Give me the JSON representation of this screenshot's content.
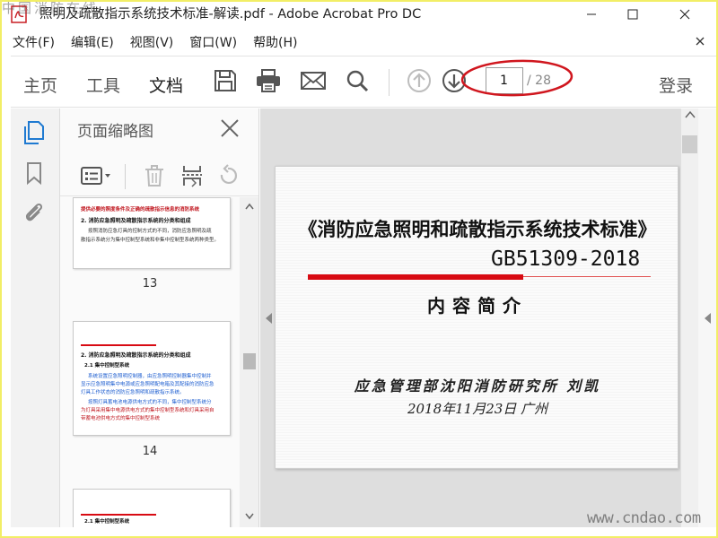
{
  "window": {
    "title": "照明及疏散指示系统技术标准-解读.pdf - Adobe Acrobat Pro DC"
  },
  "watermark": {
    "top": "中国消防在线",
    "bottom": "www.cndao.com"
  },
  "menu": {
    "items": [
      "文件(F)",
      "编辑(E)",
      "视图(V)",
      "窗口(W)",
      "帮助(H)"
    ]
  },
  "toolbar": {
    "tabs": [
      "主页",
      "工具",
      "文档"
    ],
    "active_tab": "文档",
    "icons": [
      "save-icon",
      "print-icon",
      "email-icon",
      "search-icon",
      "prev-page-icon",
      "next-page-icon"
    ],
    "page_current": "1",
    "page_total": "/ 28",
    "login": "登录",
    "highlight_color": "#d0161e"
  },
  "rail": {
    "icons": [
      "page-thumbnails-icon",
      "bookmark-icon",
      "attachment-icon"
    ],
    "accent": "#1f7ad1"
  },
  "thumbnail_panel": {
    "title": "页面缩略图",
    "thumbs": [
      {
        "page": "13",
        "lines": [
          {
            "text": "提供必要的照度条件及正确的疏散指示信息的消防系统",
            "color": "#c0161e"
          },
          {
            "text": "2. 消防应急照明及疏散指示系统的分类和组成",
            "color": "#111"
          },
          {
            "text": "按照消防应急灯具的控制方式的不同，消防应急照明及疏",
            "color": "#333"
          },
          {
            "text": "散指示系统分为集中控制型系统和非集中控制型系统两种类型。",
            "color": "#333"
          }
        ]
      },
      {
        "page": "14",
        "lines": [
          {
            "text": "2. 消防应急照明及疏散指示系统的分类和组成",
            "color": "#111"
          },
          {
            "text": "2.1 集中控制型系统",
            "color": "#111"
          },
          {
            "text": "系统设置应急照明控制器，由应急照明控制器集中控制并",
            "color": "#1f5fd0"
          },
          {
            "text": "显示应急照明集中电源或应急照明配电箱及其配接的消防应急",
            "color": "#1f5fd0"
          },
          {
            "text": "灯具工作状态的消防应急照明和疏散指示系统。",
            "color": "#1f5fd0"
          },
          {
            "text": "按照灯具蓄电池电源供电方式的不同，集中控制型系统分",
            "color": "#1f5fd0"
          },
          {
            "text": "为灯具采用集中电源供电方式的集中控制型系统和灯具采用自",
            "color": "#c0161e"
          },
          {
            "text": "带蓄电池供电方式的集中控制型系统",
            "color": "#c0161e"
          }
        ]
      },
      {
        "page": "",
        "lines": [
          {
            "text": "2.1 集中控制型系统",
            "color": "#111"
          }
        ]
      }
    ]
  },
  "document": {
    "title": "《消防应急照明和疏散指示系统技术标准》",
    "code": "GB51309-2018",
    "subtitle": "内容简介",
    "author": "应急管理部沈阳消防研究所 刘凯",
    "date": "2018年11月23日      广州",
    "accent": "#d80b13"
  }
}
